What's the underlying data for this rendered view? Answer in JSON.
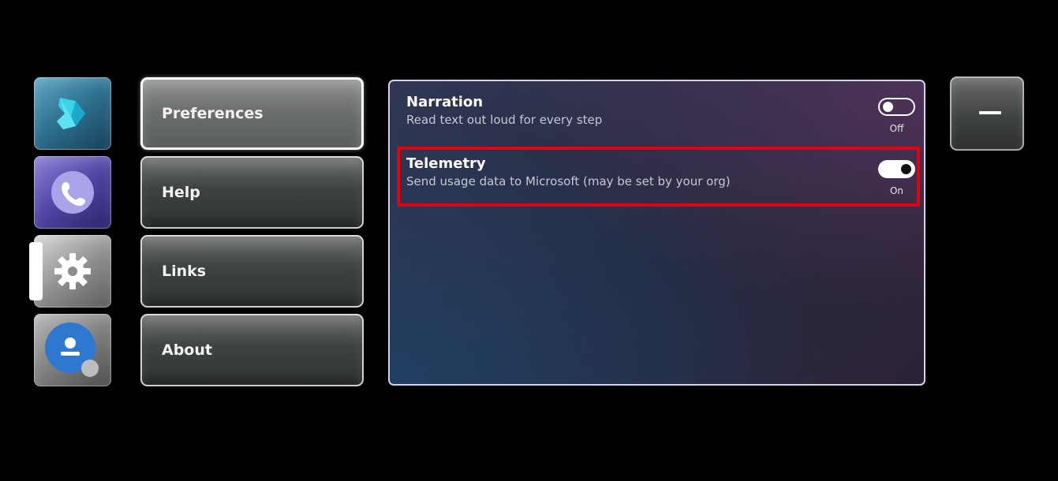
{
  "app_rail": {
    "items": [
      {
        "icon": "dynamics-365-logo-icon"
      },
      {
        "icon": "phone-icon"
      },
      {
        "icon": "settings-gear-icon",
        "active": true
      },
      {
        "icon": "profile-icon"
      }
    ]
  },
  "menu": {
    "items": [
      {
        "label": "Preferences",
        "active": true
      },
      {
        "label": "Help"
      },
      {
        "label": "Links"
      },
      {
        "label": "About"
      }
    ]
  },
  "settings": {
    "narration": {
      "title": "Narration",
      "description": "Read text out loud for every step",
      "state": "Off"
    },
    "telemetry": {
      "title": "Telemetry",
      "description": "Send usage data to Microsoft (may be set by your org)",
      "state": "On"
    }
  },
  "window_controls": {
    "minimize_icon": "minimize-icon"
  },
  "colors": {
    "background": "#000000",
    "highlight": "#e3000f",
    "panel_border": "#d8d0e8"
  }
}
